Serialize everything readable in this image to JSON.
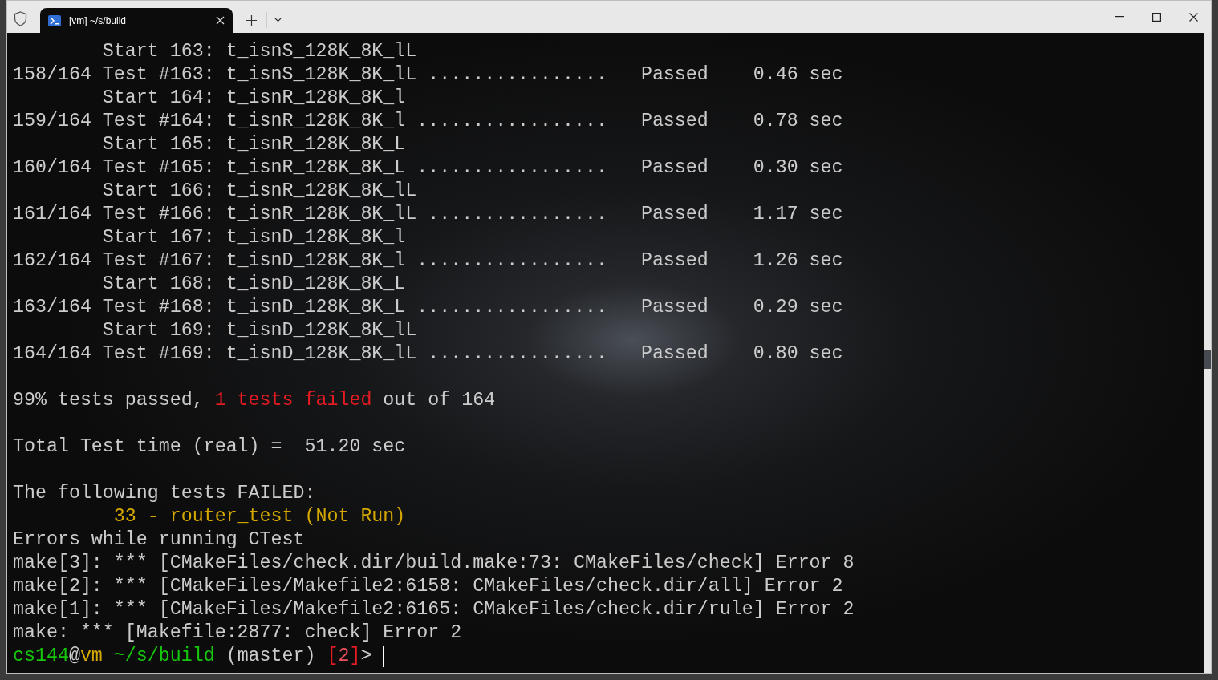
{
  "tab": {
    "title": "[vm] ~/s/build",
    "selected": true
  },
  "terminal": {
    "lines": [
      {
        "kind": "text",
        "segments": [
          {
            "text": "        Start 163: t_isnS_128K_8K_lL",
            "color": "#cccccc"
          }
        ]
      },
      {
        "kind": "text",
        "segments": [
          {
            "text": "158/164 Test #163: t_isnS_128K_8K_lL ................   Passed    0.46 sec",
            "color": "#cccccc"
          }
        ]
      },
      {
        "kind": "text",
        "segments": [
          {
            "text": "        Start 164: t_isnR_128K_8K_l",
            "color": "#cccccc"
          }
        ]
      },
      {
        "kind": "text",
        "segments": [
          {
            "text": "159/164 Test #164: t_isnR_128K_8K_l .................   Passed    0.78 sec",
            "color": "#cccccc"
          }
        ]
      },
      {
        "kind": "text",
        "segments": [
          {
            "text": "        Start 165: t_isnR_128K_8K_L",
            "color": "#cccccc"
          }
        ]
      },
      {
        "kind": "text",
        "segments": [
          {
            "text": "160/164 Test #165: t_isnR_128K_8K_L .................   Passed    0.30 sec",
            "color": "#cccccc"
          }
        ]
      },
      {
        "kind": "text",
        "segments": [
          {
            "text": "        Start 166: t_isnR_128K_8K_lL",
            "color": "#cccccc"
          }
        ]
      },
      {
        "kind": "text",
        "segments": [
          {
            "text": "161/164 Test #166: t_isnR_128K_8K_lL ................   Passed    1.17 sec",
            "color": "#cccccc"
          }
        ]
      },
      {
        "kind": "text",
        "segments": [
          {
            "text": "        Start 167: t_isnD_128K_8K_l",
            "color": "#cccccc"
          }
        ]
      },
      {
        "kind": "text",
        "segments": [
          {
            "text": "162/164 Test #167: t_isnD_128K_8K_l .................   Passed    1.26 sec",
            "color": "#cccccc"
          }
        ]
      },
      {
        "kind": "text",
        "segments": [
          {
            "text": "        Start 168: t_isnD_128K_8K_L",
            "color": "#cccccc"
          }
        ]
      },
      {
        "kind": "text",
        "segments": [
          {
            "text": "163/164 Test #168: t_isnD_128K_8K_L .................   Passed    0.29 sec",
            "color": "#cccccc"
          }
        ]
      },
      {
        "kind": "text",
        "segments": [
          {
            "text": "        Start 169: t_isnD_128K_8K_lL",
            "color": "#cccccc"
          }
        ]
      },
      {
        "kind": "text",
        "segments": [
          {
            "text": "164/164 Test #169: t_isnD_128K_8K_lL ................   Passed    0.80 sec",
            "color": "#cccccc"
          }
        ]
      },
      {
        "kind": "blank"
      },
      {
        "kind": "text",
        "segments": [
          {
            "text": "99% tests passed, ",
            "color": "#cccccc"
          },
          {
            "text": "1 tests failed",
            "color": "#e41b23"
          },
          {
            "text": " out of 164",
            "color": "#cccccc"
          }
        ]
      },
      {
        "kind": "blank"
      },
      {
        "kind": "text",
        "segments": [
          {
            "text": "Total Test time (real) =  51.20 sec",
            "color": "#cccccc"
          }
        ]
      },
      {
        "kind": "blank"
      },
      {
        "kind": "text",
        "segments": [
          {
            "text": "The following tests FAILED:",
            "color": "#cccccc"
          }
        ]
      },
      {
        "kind": "text",
        "segments": [
          {
            "text": "         33 - router_test (Not Run)",
            "color": "#d4a800"
          }
        ]
      },
      {
        "kind": "text",
        "segments": [
          {
            "text": "Errors while running CTest",
            "color": "#cccccc"
          }
        ]
      },
      {
        "kind": "text",
        "segments": [
          {
            "text": "make[3]: *** [CMakeFiles/check.dir/build.make:73: CMakeFiles/check] Error 8",
            "color": "#cccccc"
          }
        ]
      },
      {
        "kind": "text",
        "segments": [
          {
            "text": "make[2]: *** [CMakeFiles/Makefile2:6158: CMakeFiles/check.dir/all] Error 2",
            "color": "#cccccc"
          }
        ]
      },
      {
        "kind": "text",
        "segments": [
          {
            "text": "make[1]: *** [CMakeFiles/Makefile2:6165: CMakeFiles/check.dir/rule] Error 2",
            "color": "#cccccc"
          }
        ]
      },
      {
        "kind": "text",
        "segments": [
          {
            "text": "make: *** [Makefile:2877: check] Error 2",
            "color": "#cccccc"
          }
        ]
      },
      {
        "kind": "text",
        "segments": [
          {
            "text": "cs144",
            "color": "#16c60c"
          },
          {
            "text": "@",
            "color": "#cccccc"
          },
          {
            "text": "vm",
            "color": "#d4a800"
          },
          {
            "text": " ~/s/build",
            "color": "#16c60c"
          },
          {
            "text": " (master) ",
            "color": "#cccccc"
          },
          {
            "text": "[",
            "color": "#e41b23"
          },
          {
            "text": "2",
            "color": "#f0505c"
          },
          {
            "text": "]",
            "color": "#e41b23"
          },
          {
            "text": "> ",
            "color": "#cccccc"
          }
        ]
      }
    ],
    "cursor": true
  }
}
